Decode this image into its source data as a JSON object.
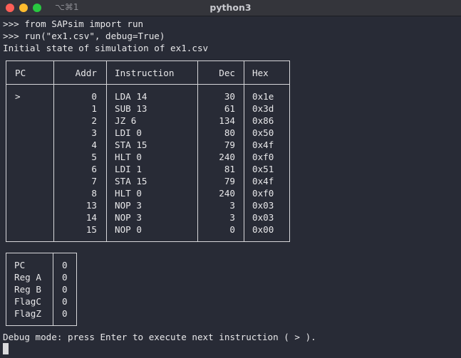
{
  "window": {
    "shortcut": "⌥⌘1",
    "title": "python3"
  },
  "console": {
    "line1": ">>> from SAPsim import run",
    "line2": ">>> run(\"ex1.csv\", debug=True)",
    "line3": "Initial state of simulation of ex1.csv",
    "footer": "Debug mode: press Enter to execute next instruction ( > )."
  },
  "program_table": {
    "headers": [
      "PC",
      "Addr",
      "Instruction",
      "Dec",
      "Hex"
    ],
    "rows": [
      [
        ">",
        "0",
        "LDA 14",
        "30",
        "0x1e"
      ],
      [
        "",
        "1",
        "SUB 13",
        "61",
        "0x3d"
      ],
      [
        "",
        "2",
        "JZ 6",
        "134",
        "0x86"
      ],
      [
        "",
        "3",
        "LDI 0",
        "80",
        "0x50"
      ],
      [
        "",
        "4",
        "STA 15",
        "79",
        "0x4f"
      ],
      [
        "",
        "5",
        "HLT 0",
        "240",
        "0xf0"
      ],
      [
        "",
        "6",
        "LDI 1",
        "81",
        "0x51"
      ],
      [
        "",
        "7",
        "STA 15",
        "79",
        "0x4f"
      ],
      [
        "",
        "8",
        "HLT 0",
        "240",
        "0xf0"
      ],
      [
        "",
        "13",
        "NOP 3",
        "3",
        "0x03"
      ],
      [
        "",
        "14",
        "NOP 3",
        "3",
        "0x03"
      ],
      [
        "",
        "15",
        "NOP 0",
        "0",
        "0x00"
      ]
    ]
  },
  "registers": [
    [
      "PC",
      "0"
    ],
    [
      "Reg A",
      "0"
    ],
    [
      "Reg B",
      "0"
    ],
    [
      "FlagC",
      "0"
    ],
    [
      "FlagZ",
      "0"
    ]
  ]
}
